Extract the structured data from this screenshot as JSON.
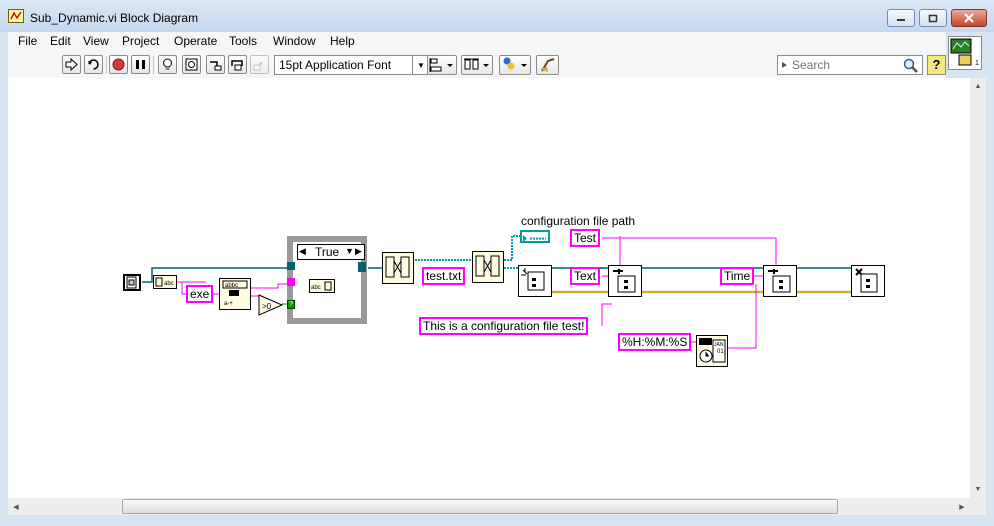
{
  "window": {
    "title": "Sub_Dynamic.vi Block Diagram"
  },
  "menu": [
    "File",
    "Edit",
    "View",
    "Project",
    "Operate",
    "Tools",
    "Window",
    "Help"
  ],
  "toolbar": {
    "font_select": "15pt Application Font",
    "search_placeholder": "Search",
    "help_glyph": "?"
  },
  "diagram": {
    "case_selector": "True",
    "label_config_path": "configuration file path",
    "const_exe": "exe",
    "const_test_txt": "test.txt",
    "const_test": "Test",
    "const_text": "Text",
    "const_time": "Time",
    "const_config_text": "This is a configuration file test!",
    "const_time_format": "%H:%M:%S"
  },
  "colors": {
    "string_wire": "#ff00ff",
    "refnum_wire": "#00656b",
    "path_wire": "#00a0a0"
  }
}
